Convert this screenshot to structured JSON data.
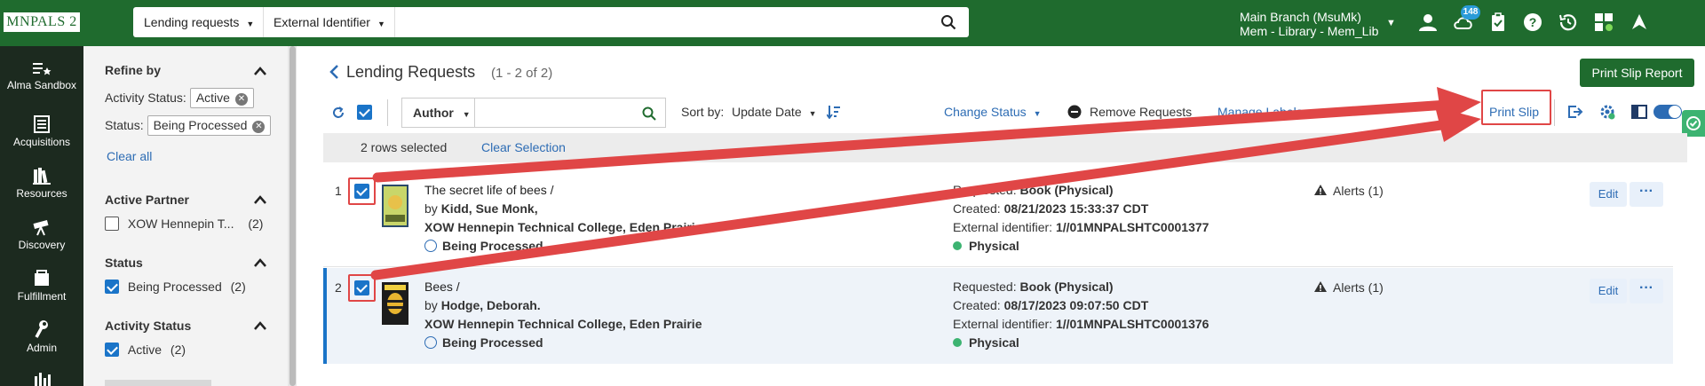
{
  "header": {
    "logo": "MNPALS 2",
    "search_scope": "Lending requests",
    "search_field": "External Identifier",
    "institution_line1": "Main Branch (MsuMk)",
    "institution_line2": "Mem - Library - Mem_Lib",
    "notifications_count": "148"
  },
  "leftnav": {
    "items": [
      {
        "label": "Alma Sandbox",
        "icon": "star-list-icon"
      },
      {
        "label": "Acquisitions",
        "icon": "ledger-icon"
      },
      {
        "label": "Resources",
        "icon": "books-icon"
      },
      {
        "label": "Discovery",
        "icon": "telescope-icon"
      },
      {
        "label": "Fulfillment",
        "icon": "fulfillment-icon"
      },
      {
        "label": "Admin",
        "icon": "wrench-icon"
      }
    ]
  },
  "facets": {
    "refine_by": "Refine by",
    "activity_status_label": "Activity Status:",
    "activity_status_chip": "Active",
    "status_label": "Status:",
    "status_chip": "Being Processed",
    "clear_all": "Clear all",
    "groups": [
      {
        "title": "Active Partner",
        "option": "XOW Hennepin T...",
        "count": "(2)",
        "checked": false
      },
      {
        "title": "Status",
        "option": "Being Processed",
        "count": "(2)",
        "checked": true
      },
      {
        "title": "Activity Status",
        "option": "Active",
        "count": "(2)",
        "checked": true
      }
    ]
  },
  "main": {
    "title": "Lending Requests",
    "count": "(1 - 2 of 2)",
    "print_slip_report": "Print Slip Report",
    "search_field_label": "Author",
    "sort_by_label": "Sort by:",
    "sort_by_value": "Update Date",
    "change_status": "Change Status",
    "remove_requests": "Remove Requests",
    "manage_labels": "Manage Labels",
    "print_slip": "Print Slip",
    "rows_selected": "2 rows selected",
    "clear_selection": "Clear Selection"
  },
  "rows": [
    {
      "num": "1",
      "title": "The secret life of bees /",
      "by_prefix": "by",
      "author": "Kidd, Sue Monk,",
      "partner": "XOW Hennepin Technical College, Eden Prairie",
      "status": "Being Processed",
      "requested_label": "Requested:",
      "requested": "Book (Physical)",
      "created_label": "Created:",
      "created": "08/21/2023 15:33:37 CDT",
      "ext_label": "External identifier:",
      "ext_id": "1//01MNPALSHTC0001377",
      "format": "Physical",
      "alerts": "Alerts (1)",
      "edit": "Edit"
    },
    {
      "num": "2",
      "title": "Bees /",
      "by_prefix": "by",
      "author": "Hodge, Deborah.",
      "partner": "XOW Hennepin Technical College, Eden Prairie",
      "status": "Being Processed",
      "requested_label": "Requested:",
      "requested": "Book (Physical)",
      "created_label": "Created:",
      "created": "08/17/2023 09:07:50 CDT",
      "ext_label": "External identifier:",
      "ext_id": "1//01MNPALSHTC0001376",
      "format": "Physical",
      "alerts": "Alerts (1)",
      "edit": "Edit"
    }
  ],
  "colors": {
    "header_green": "#1f6b2e",
    "nav_dark": "#1c2a1f",
    "link_blue": "#2d6cb4",
    "annotation_red": "#e04646"
  }
}
